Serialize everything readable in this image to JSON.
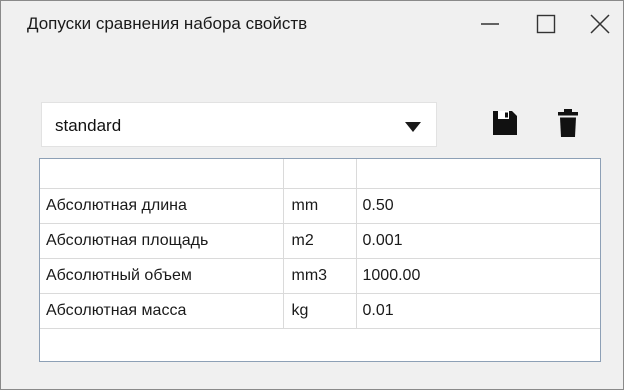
{
  "window": {
    "title": "Допуски сравнения набора свойств"
  },
  "toolbar": {
    "preset_value": "standard"
  },
  "grid": {
    "columns": [
      "",
      "",
      ""
    ],
    "rows": [
      {
        "property": "Абсолютная длина",
        "unit": "mm",
        "value": "0.50"
      },
      {
        "property": "Абсолютная площадь",
        "unit": "m2",
        "value": "0.001"
      },
      {
        "property": "Абсолютный объем",
        "unit": "mm3",
        "value": "1000.00"
      },
      {
        "property": "Абсолютная масса",
        "unit": "kg",
        "value": "0.01"
      }
    ]
  },
  "icons": {
    "save": "save-icon",
    "delete": "trash-icon",
    "dropdown": "dropdown-arrow-icon"
  }
}
